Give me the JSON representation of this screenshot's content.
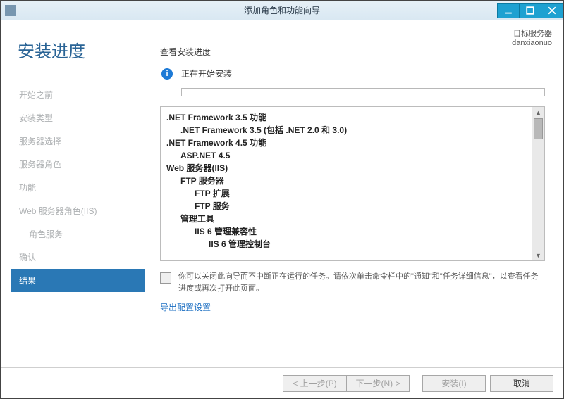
{
  "window": {
    "title": "添加角色和功能向导"
  },
  "page_title": "安装进度",
  "target": {
    "label": "目标服务器",
    "name": "danxiaonuo"
  },
  "steps": [
    {
      "label": "开始之前"
    },
    {
      "label": "安装类型"
    },
    {
      "label": "服务器选择"
    },
    {
      "label": "服务器角色"
    },
    {
      "label": "功能"
    },
    {
      "label": "Web 服务器角色(IIS)"
    },
    {
      "label": "角色服务",
      "sub": true
    },
    {
      "label": "确认"
    },
    {
      "label": "结果",
      "active": true
    }
  ],
  "view_label": "查看安装进度",
  "status_text": "正在开始安装",
  "features": [
    {
      "text": ".NET Framework 3.5 功能",
      "bold": true,
      "indent": 0
    },
    {
      "text": ".NET Framework 3.5 (包括 .NET 2.0 和 3.0)",
      "bold": true,
      "indent": 1
    },
    {
      "text": ".NET Framework 4.5 功能",
      "bold": true,
      "indent": 0
    },
    {
      "text": "ASP.NET 4.5",
      "bold": true,
      "indent": 1
    },
    {
      "text": "Web 服务器(IIS)",
      "bold": true,
      "indent": 0
    },
    {
      "text": "FTP 服务器",
      "bold": true,
      "indent": 1
    },
    {
      "text": "FTP 扩展",
      "bold": true,
      "indent": 2
    },
    {
      "text": "FTP 服务",
      "bold": true,
      "indent": 2
    },
    {
      "text": "管理工具",
      "bold": true,
      "indent": 1
    },
    {
      "text": "IIS 6 管理兼容性",
      "bold": true,
      "indent": 2
    },
    {
      "text": "IIS 6 管理控制台",
      "bold": true,
      "indent": 3
    }
  ],
  "note": "你可以关闭此向导而不中断正在运行的任务。请依次单击命令栏中的\"通知\"和\"任务详细信息\"，以查看任务进度或再次打开此页面。",
  "export_link": "导出配置设置",
  "buttons": {
    "prev": "< 上一步(P)",
    "next": "下一步(N) >",
    "install": "安装(I)",
    "cancel": "取消"
  }
}
